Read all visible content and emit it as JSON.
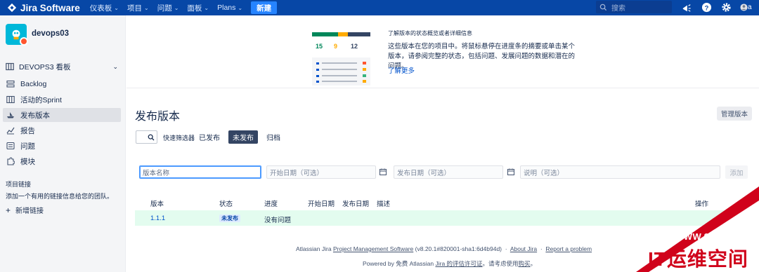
{
  "topnav": {
    "logo": "Jira Software",
    "items": [
      {
        "label": "仪表板"
      },
      {
        "label": "项目"
      },
      {
        "label": "问题"
      },
      {
        "label": "面板"
      },
      {
        "label": "Plans"
      }
    ],
    "create_label": "新建",
    "search_placeholder": "搜索",
    "avatar_text": "a"
  },
  "sidebar": {
    "project_name": "devops03",
    "board_selector": "DEVOPS3 看板",
    "items": [
      {
        "label": "Backlog",
        "icon": "backlog-icon"
      },
      {
        "label": "活动的Sprint",
        "icon": "board-icon"
      },
      {
        "label": "发布版本",
        "icon": "ship-icon",
        "active": true
      },
      {
        "label": "报告",
        "icon": "chart-icon"
      },
      {
        "label": "问题",
        "icon": "issues-icon"
      },
      {
        "label": "模块",
        "icon": "puzzle-icon"
      }
    ],
    "section_title": "项目链接",
    "section_hint": "添加一个有用的链接信息给您的团队。",
    "add_link": "新增链接"
  },
  "banner": {
    "illustration_numbers": [
      "15",
      "9",
      "12"
    ],
    "small_title": "了解版本的状态概览或者详细信息",
    "text": "这些版本在您的项目中。将鼠标悬停在进度条的摘要或单击某个版本，请参阅完整的状态，包括问题、发展问题的数据和潜在的问题。",
    "link": "了解更多"
  },
  "main": {
    "title": "发布版本",
    "manage_button": "管理版本",
    "filter_label": "快速筛选器",
    "filters": [
      "已发布",
      "未发布",
      "归档"
    ],
    "form": {
      "name_placeholder": "版本名称",
      "start_placeholder": "开始日期（可选）",
      "release_placeholder": "发布日期（可选）",
      "desc_placeholder": "说明（可选）",
      "add_button": "添加"
    },
    "table": {
      "headers": [
        "版本",
        "状态",
        "进度",
        "开始日期",
        "发布日期",
        "描述",
        "操作"
      ],
      "rows": [
        {
          "version": "1.1.1",
          "status": "未发布",
          "progress": "没有问题"
        }
      ]
    }
  },
  "footer": {
    "line1_prefix": "Atlassian Jira",
    "line1_link": "Project Management Software",
    "line1_version": "(v8.20.1#820001-sha1:6d4b94d)",
    "about": "About Jira",
    "report": "Report a problem",
    "line2_prefix": "Powered by 免费 Atlassian",
    "line2_link": "Jira 的评估许可证",
    "line2_mid": "。请考虑使用",
    "line2_link2": "购买",
    "line2_end": "。"
  },
  "watermark": {
    "url": "WWW.94IP.COM",
    "text": "IT运维空间"
  },
  "colors": {
    "nav": "#0747a6",
    "accent": "#0052cc",
    "selected_row": "#e3fcef",
    "watermark_red": "#d0021b"
  }
}
